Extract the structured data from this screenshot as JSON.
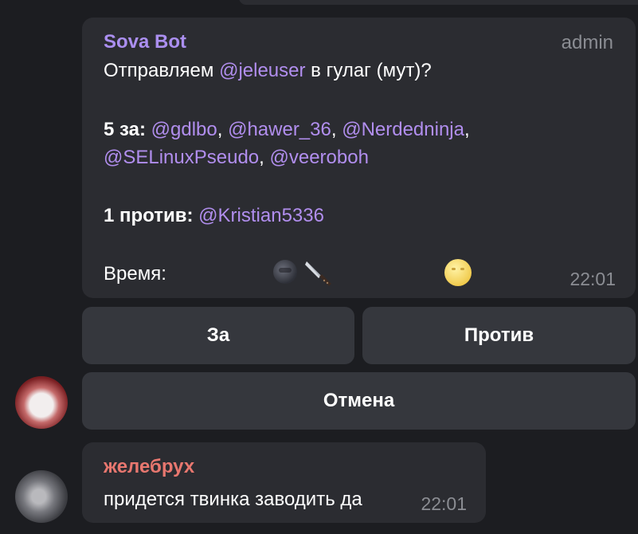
{
  "bot_message": {
    "sender": "Sova Bot",
    "role": "admin",
    "line1_prefix": "Отправляем ",
    "line1_mention": "@jeleuser",
    "line1_suffix": " в гулаг (мут)?",
    "for_label": "5 за:",
    "for_mentions": [
      "@gdlbo",
      "@hawer_36",
      "@Nerdedninja",
      "@SELinuxPseudo",
      "@veeroboh"
    ],
    "against_label": "1 против:",
    "against_mentions": [
      "@Kristian5336"
    ],
    "time_label": "Время:",
    "time": "22:01"
  },
  "keyboard": {
    "for_button": "За",
    "against_button": "Против",
    "cancel_button": "Отмена"
  },
  "user_message": {
    "sender": "желебрух",
    "text": "придется твинка заводить да",
    "time": "22:01"
  },
  "colors": {
    "background": "#1c1d21",
    "bubble": "#2b2c31",
    "button": "#35373d",
    "bot_name": "#ab8ff0",
    "mention": "#b18eee",
    "user_name": "#e8776f",
    "meta": "#8b8d93"
  },
  "icons": [
    "new-moon-face-icon",
    "knife-icon",
    "full-moon-face-icon"
  ]
}
